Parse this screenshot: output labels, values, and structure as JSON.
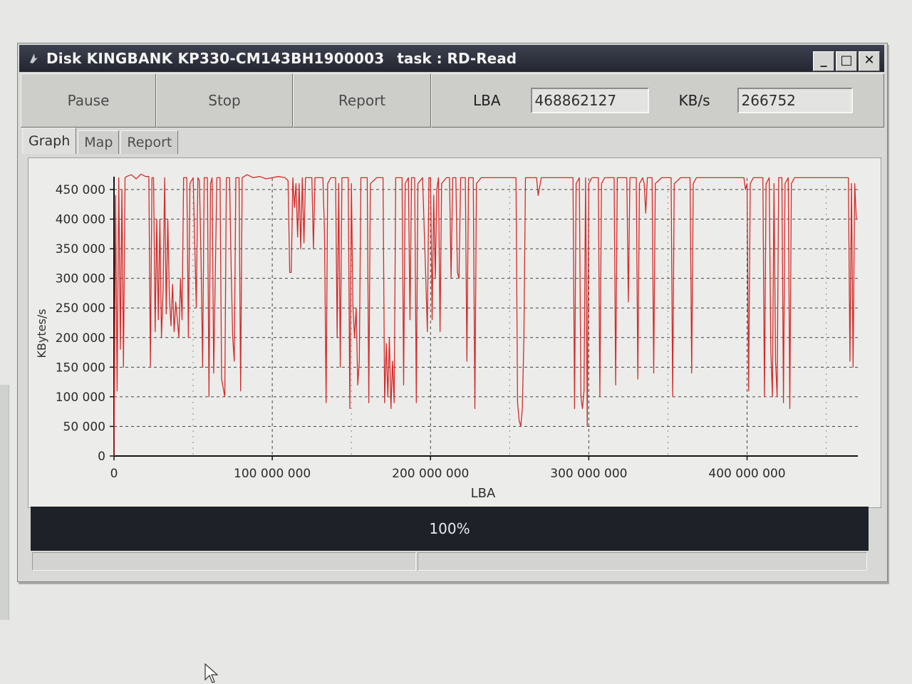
{
  "window": {
    "title": "Disk KINGBANK KP330-CM143BH1900003",
    "task": "task : RD-Read",
    "buttons": {
      "minimize": "_",
      "maximize": "□",
      "close": "✕"
    }
  },
  "toolbar": {
    "pause_label": "Pause",
    "stop_label": "Stop",
    "report_label": "Report",
    "lba_label": "LBA",
    "lba_value": "468862127",
    "speed_label": "KB/s",
    "speed_value": "266752"
  },
  "tabs": [
    {
      "label": "Graph",
      "active": true
    },
    {
      "label": "Map",
      "active": false
    },
    {
      "label": "Report",
      "active": false
    }
  ],
  "progress": {
    "value": 1.0,
    "text": "100%"
  },
  "colors": {
    "line": "#d42a2a",
    "titlebar": "#2b2e38",
    "progress": "#1f2129"
  },
  "chart_data": {
    "type": "line",
    "xlabel": "LBA",
    "ylabel": "KBytes/s",
    "xlim": [
      0,
      470000000
    ],
    "ylim": [
      0,
      450000
    ],
    "x_ticks": [
      0,
      100000000,
      200000000,
      300000000,
      400000000
    ],
    "x_tick_labels": [
      "0",
      "100 000 000",
      "200 000 000",
      "300 000 000",
      "400 000 000"
    ],
    "y_ticks": [
      0,
      50000,
      100000,
      150000,
      200000,
      250000,
      300000,
      350000,
      400000,
      450000
    ],
    "y_tick_labels": [
      "0",
      "50 000",
      "100 000",
      "150 000",
      "200 000",
      "250 000",
      "300 000",
      "350 000",
      "400 000",
      "450 000"
    ],
    "grid": true,
    "series": [
      {
        "values": [
          [
            0,
            0
          ],
          [
            1000000,
            440000
          ],
          [
            2000000,
            110000
          ],
          [
            3000000,
            470000
          ],
          [
            4000000,
            180000
          ],
          [
            5000000,
            450000
          ],
          [
            6000000,
            150000
          ],
          [
            7000000,
            470000
          ],
          [
            8000000,
            472000
          ],
          [
            11000000,
            475000
          ],
          [
            14000000,
            468000
          ],
          [
            17000000,
            476000
          ],
          [
            20000000,
            472000
          ],
          [
            22000000,
            472000
          ],
          [
            23000000,
            150000
          ],
          [
            24000000,
            470000
          ],
          [
            25000000,
            470000
          ],
          [
            26000000,
            210000
          ],
          [
            27000000,
            400000
          ],
          [
            28000000,
            230000
          ],
          [
            29000000,
            400000
          ],
          [
            30000000,
            200000
          ],
          [
            31000000,
            280000
          ],
          [
            32000000,
            470000
          ],
          [
            33000000,
            240000
          ],
          [
            34000000,
            400000
          ],
          [
            35000000,
            270000
          ],
          [
            36000000,
            220000
          ],
          [
            37000000,
            290000
          ],
          [
            38000000,
            210000
          ],
          [
            39000000,
            260000
          ],
          [
            40000000,
            230000
          ],
          [
            41000000,
            200000
          ],
          [
            42000000,
            300000
          ],
          [
            43000000,
            230000
          ],
          [
            44000000,
            470000
          ],
          [
            46000000,
            470000
          ],
          [
            47000000,
            200000
          ],
          [
            48000000,
            460000
          ],
          [
            50000000,
            470000
          ],
          [
            52000000,
            250000
          ],
          [
            53000000,
            470000
          ],
          [
            54000000,
            465000
          ],
          [
            55000000,
            330000
          ],
          [
            56000000,
            150000
          ],
          [
            57000000,
            470000
          ],
          [
            59000000,
            470000
          ],
          [
            60000000,
            100000
          ],
          [
            61000000,
            460000
          ],
          [
            62000000,
            470000
          ],
          [
            63000000,
            140000
          ],
          [
            65000000,
            470000
          ],
          [
            67000000,
            470000
          ],
          [
            68000000,
            130000
          ],
          [
            70000000,
            100000
          ],
          [
            71000000,
            470000
          ],
          [
            73000000,
            470000
          ],
          [
            74000000,
            320000
          ],
          [
            75000000,
            200000
          ],
          [
            76000000,
            160000
          ],
          [
            77000000,
            470000
          ],
          [
            79000000,
            470000
          ],
          [
            80000000,
            110000
          ],
          [
            81000000,
            470000
          ],
          [
            84000000,
            475000
          ],
          [
            88000000,
            470000
          ],
          [
            92000000,
            472000
          ],
          [
            96000000,
            468000
          ],
          [
            100000000,
            470000
          ],
          [
            104000000,
            472000
          ],
          [
            108000000,
            470000
          ],
          [
            110000000,
            465000
          ],
          [
            111000000,
            310000
          ],
          [
            112000000,
            310000
          ],
          [
            113000000,
            470000
          ],
          [
            114000000,
            420000
          ],
          [
            115000000,
            460000
          ],
          [
            116000000,
            370000
          ],
          [
            117000000,
            460000
          ],
          [
            118000000,
            350000
          ],
          [
            119000000,
            470000
          ],
          [
            120000000,
            360000
          ],
          [
            121000000,
            470000
          ],
          [
            125000000,
            470000
          ],
          [
            126000000,
            350000
          ],
          [
            127000000,
            470000
          ],
          [
            130000000,
            470000
          ],
          [
            132000000,
            470000
          ],
          [
            133000000,
            380000
          ],
          [
            134000000,
            90000
          ],
          [
            135000000,
            460000
          ],
          [
            137000000,
            470000
          ],
          [
            140000000,
            470000
          ],
          [
            141000000,
            200000
          ],
          [
            142000000,
            460000
          ],
          [
            143000000,
            150000
          ],
          [
            144000000,
            470000
          ],
          [
            148000000,
            470000
          ],
          [
            149000000,
            80000
          ],
          [
            150000000,
            460000
          ],
          [
            151000000,
            250000
          ],
          [
            152000000,
            200000
          ],
          [
            153000000,
            250000
          ],
          [
            154000000,
            120000
          ],
          [
            155000000,
            160000
          ],
          [
            156000000,
            470000
          ],
          [
            160000000,
            470000
          ],
          [
            161000000,
            90000
          ],
          [
            162000000,
            460000
          ],
          [
            166000000,
            470000
          ],
          [
            170000000,
            470000
          ],
          [
            171000000,
            90000
          ],
          [
            172000000,
            190000
          ],
          [
            173000000,
            100000
          ],
          [
            174000000,
            200000
          ],
          [
            175000000,
            80000
          ],
          [
            176000000,
            160000
          ],
          [
            177000000,
            90000
          ],
          [
            178000000,
            470000
          ],
          [
            182000000,
            470000
          ],
          [
            183000000,
            120000
          ],
          [
            184000000,
            460000
          ],
          [
            186000000,
            470000
          ],
          [
            187000000,
            230000
          ],
          [
            188000000,
            470000
          ],
          [
            190000000,
            470000
          ],
          [
            191000000,
            90000
          ],
          [
            192000000,
            460000
          ],
          [
            195000000,
            470000
          ],
          [
            197000000,
            300000
          ],
          [
            198000000,
            210000
          ],
          [
            199000000,
            470000
          ],
          [
            200000000,
            470000
          ],
          [
            201000000,
            230000
          ],
          [
            202000000,
            440000
          ],
          [
            203000000,
            300000
          ],
          [
            204000000,
            450000
          ],
          [
            205000000,
            470000
          ],
          [
            206000000,
            210000
          ],
          [
            207000000,
            460000
          ],
          [
            210000000,
            470000
          ],
          [
            212000000,
            470000
          ],
          [
            213000000,
            300000
          ],
          [
            214000000,
            470000
          ],
          [
            216000000,
            470000
          ],
          [
            217000000,
            310000
          ],
          [
            218000000,
            300000
          ],
          [
            219000000,
            470000
          ],
          [
            222000000,
            470000
          ],
          [
            223000000,
            160000
          ],
          [
            224000000,
            470000
          ],
          [
            226000000,
            470000
          ],
          [
            227000000,
            470000
          ],
          [
            228000000,
            80000
          ],
          [
            229000000,
            460000
          ],
          [
            232000000,
            470000
          ],
          [
            234000000,
            470000
          ],
          [
            235000000,
            470000
          ],
          [
            236000000,
            470000
          ],
          [
            238000000,
            470000
          ],
          [
            240000000,
            470000
          ],
          [
            245000000,
            470000
          ],
          [
            248000000,
            470000
          ],
          [
            252000000,
            470000
          ],
          [
            254000000,
            470000
          ],
          [
            255000000,
            90000
          ],
          [
            256000000,
            60000
          ],
          [
            257000000,
            50000
          ],
          [
            258000000,
            80000
          ],
          [
            259000000,
            200000
          ],
          [
            260000000,
            470000
          ],
          [
            264000000,
            470000
          ],
          [
            266000000,
            470000
          ],
          [
            267000000,
            470000
          ],
          [
            268000000,
            440000
          ],
          [
            270000000,
            470000
          ],
          [
            274000000,
            470000
          ],
          [
            276000000,
            470000
          ],
          [
            278000000,
            470000
          ],
          [
            280000000,
            470000
          ],
          [
            282000000,
            470000
          ],
          [
            284000000,
            470000
          ],
          [
            286000000,
            470000
          ],
          [
            288000000,
            470000
          ],
          [
            290000000,
            470000
          ],
          [
            291000000,
            80000
          ],
          [
            292000000,
            460000
          ],
          [
            294000000,
            470000
          ],
          [
            295000000,
            100000
          ],
          [
            296000000,
            80000
          ],
          [
            297000000,
            110000
          ],
          [
            298000000,
            470000
          ],
          [
            299000000,
            50000
          ],
          [
            300000000,
            460000
          ],
          [
            302000000,
            470000
          ],
          [
            306000000,
            470000
          ],
          [
            307000000,
            100000
          ],
          [
            308000000,
            460000
          ],
          [
            310000000,
            470000
          ],
          [
            314000000,
            470000
          ],
          [
            316000000,
            470000
          ],
          [
            317000000,
            120000
          ],
          [
            318000000,
            470000
          ],
          [
            322000000,
            470000
          ],
          [
            324000000,
            470000
          ],
          [
            325000000,
            260000
          ],
          [
            326000000,
            470000
          ],
          [
            328000000,
            470000
          ],
          [
            330000000,
            470000
          ],
          [
            331000000,
            130000
          ],
          [
            332000000,
            460000
          ],
          [
            334000000,
            470000
          ],
          [
            335000000,
            460000
          ],
          [
            336000000,
            410000
          ],
          [
            337000000,
            470000
          ],
          [
            338000000,
            470000
          ],
          [
            339000000,
            470000
          ],
          [
            340000000,
            470000
          ],
          [
            341000000,
            140000
          ],
          [
            342000000,
            460000
          ],
          [
            346000000,
            470000
          ],
          [
            350000000,
            470000
          ],
          [
            352000000,
            470000
          ],
          [
            353000000,
            100000
          ],
          [
            354000000,
            460000
          ],
          [
            358000000,
            470000
          ],
          [
            362000000,
            470000
          ],
          [
            364000000,
            470000
          ],
          [
            365000000,
            140000
          ],
          [
            366000000,
            460000
          ],
          [
            368000000,
            470000
          ],
          [
            372000000,
            470000
          ],
          [
            376000000,
            470000
          ],
          [
            380000000,
            470000
          ],
          [
            384000000,
            470000
          ],
          [
            388000000,
            470000
          ],
          [
            392000000,
            470000
          ],
          [
            396000000,
            470000
          ],
          [
            398000000,
            470000
          ],
          [
            399000000,
            450000
          ],
          [
            400000000,
            460000
          ],
          [
            401000000,
            110000
          ],
          [
            402000000,
            460000
          ],
          [
            404000000,
            470000
          ],
          [
            408000000,
            470000
          ],
          [
            410000000,
            470000
          ],
          [
            411000000,
            100000
          ],
          [
            412000000,
            460000
          ],
          [
            414000000,
            470000
          ],
          [
            415000000,
            180000
          ],
          [
            416000000,
            100000
          ],
          [
            417000000,
            460000
          ],
          [
            418000000,
            160000
          ],
          [
            419000000,
            100000
          ],
          [
            420000000,
            470000
          ],
          [
            422000000,
            470000
          ],
          [
            423000000,
            90000
          ],
          [
            424000000,
            460000
          ],
          [
            426000000,
            470000
          ],
          [
            427000000,
            80000
          ],
          [
            428000000,
            460000
          ],
          [
            430000000,
            470000
          ],
          [
            434000000,
            470000
          ],
          [
            438000000,
            470000
          ],
          [
            442000000,
            470000
          ],
          [
            446000000,
            470000
          ],
          [
            450000000,
            470000
          ],
          [
            454000000,
            470000
          ],
          [
            458000000,
            470000
          ],
          [
            462000000,
            470000
          ],
          [
            464000000,
            470000
          ],
          [
            465000000,
            160000
          ],
          [
            466000000,
            460000
          ],
          [
            467000000,
            150000
          ],
          [
            468000000,
            460000
          ],
          [
            469000000,
            400000
          ]
        ]
      }
    ]
  }
}
